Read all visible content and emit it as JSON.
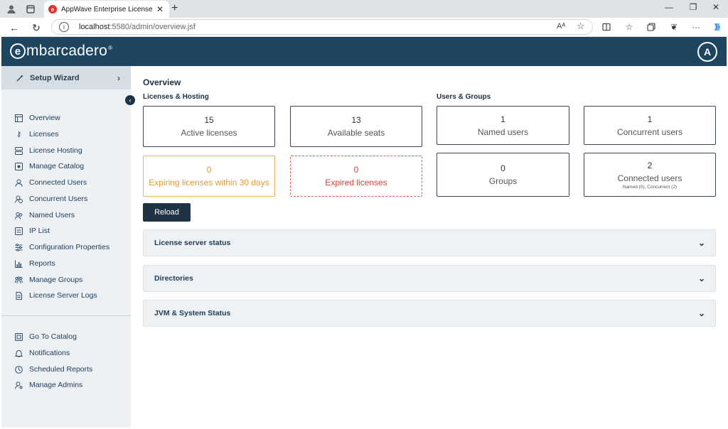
{
  "browser": {
    "tab_title": "AppWave Enterprise License Cent",
    "tab_favicon": "e",
    "tab_close": "✕",
    "new_tab": "+",
    "url_host": "localhost",
    "url_rest": ":5580/admin/overview.jsf",
    "read_aloud": "Aᴬ",
    "icons": [
      "profile-icon",
      "tab-actions-icon",
      "back-icon",
      "refresh-icon",
      "info-icon",
      "read-aloud-icon",
      "favorite-icon",
      "split-screen-icon",
      "favorites-icon",
      "collections-icon",
      "extensions-icon",
      "more-icon",
      "copilot-icon"
    ]
  },
  "header": {
    "brand_letter": "e",
    "brand_rest": "mbarcadero",
    "brand_mark": "®",
    "avatar_letter": "A",
    "background": "#1d4560"
  },
  "sidebar": {
    "wizard_label": "Setup Wizard",
    "items": [
      {
        "label": "Overview",
        "icon": "table-icon"
      },
      {
        "label": "Licenses",
        "icon": "key-icon"
      },
      {
        "label": "License Hosting",
        "icon": "server-icon"
      },
      {
        "label": "Manage Catalog",
        "icon": "catalog-icon"
      },
      {
        "label": "Connected Users",
        "icon": "user-icon"
      },
      {
        "label": "Concurrent Users",
        "icon": "user-clock-icon"
      },
      {
        "label": "Named Users",
        "icon": "users-icon"
      },
      {
        "label": "IP List",
        "icon": "list-icon"
      },
      {
        "label": "Configuration Properties",
        "icon": "sliders-icon"
      },
      {
        "label": "Reports",
        "icon": "bar-chart-icon"
      },
      {
        "label": "Manage Groups",
        "icon": "group-icon"
      },
      {
        "label": "License Server Logs",
        "icon": "document-icon"
      }
    ],
    "bottom_items": [
      {
        "label": "Go To Catalog",
        "icon": "catalog-icon"
      },
      {
        "label": "Notifications",
        "icon": "bell-icon"
      },
      {
        "label": "Scheduled Reports",
        "icon": "clock-icon"
      },
      {
        "label": "Manage Admins",
        "icon": "admin-icon"
      }
    ]
  },
  "main": {
    "title": "Overview",
    "licenses_heading": "Licenses & Hosting",
    "users_heading": "Users & Groups",
    "cards": {
      "active": {
        "value": "15",
        "label": "Active licenses"
      },
      "available": {
        "value": "13",
        "label": "Available seats"
      },
      "expiring": {
        "value": "0",
        "label": "Expiring licenses within 30 days",
        "color": "#e79a2e"
      },
      "expired": {
        "value": "0",
        "label": "Expired licenses",
        "color": "#d9423c"
      },
      "named": {
        "value": "1",
        "label": "Named users"
      },
      "concurrent": {
        "value": "1",
        "label": "Concurrent users"
      },
      "groups": {
        "value": "0",
        "label": "Groups"
      },
      "connected": {
        "value": "2",
        "label": "Connected users",
        "sub": "Named (0), Concurrent (2)"
      }
    },
    "reload_label": "Reload",
    "panels": [
      "License server status",
      "Directories",
      "JVM & System Status"
    ]
  }
}
